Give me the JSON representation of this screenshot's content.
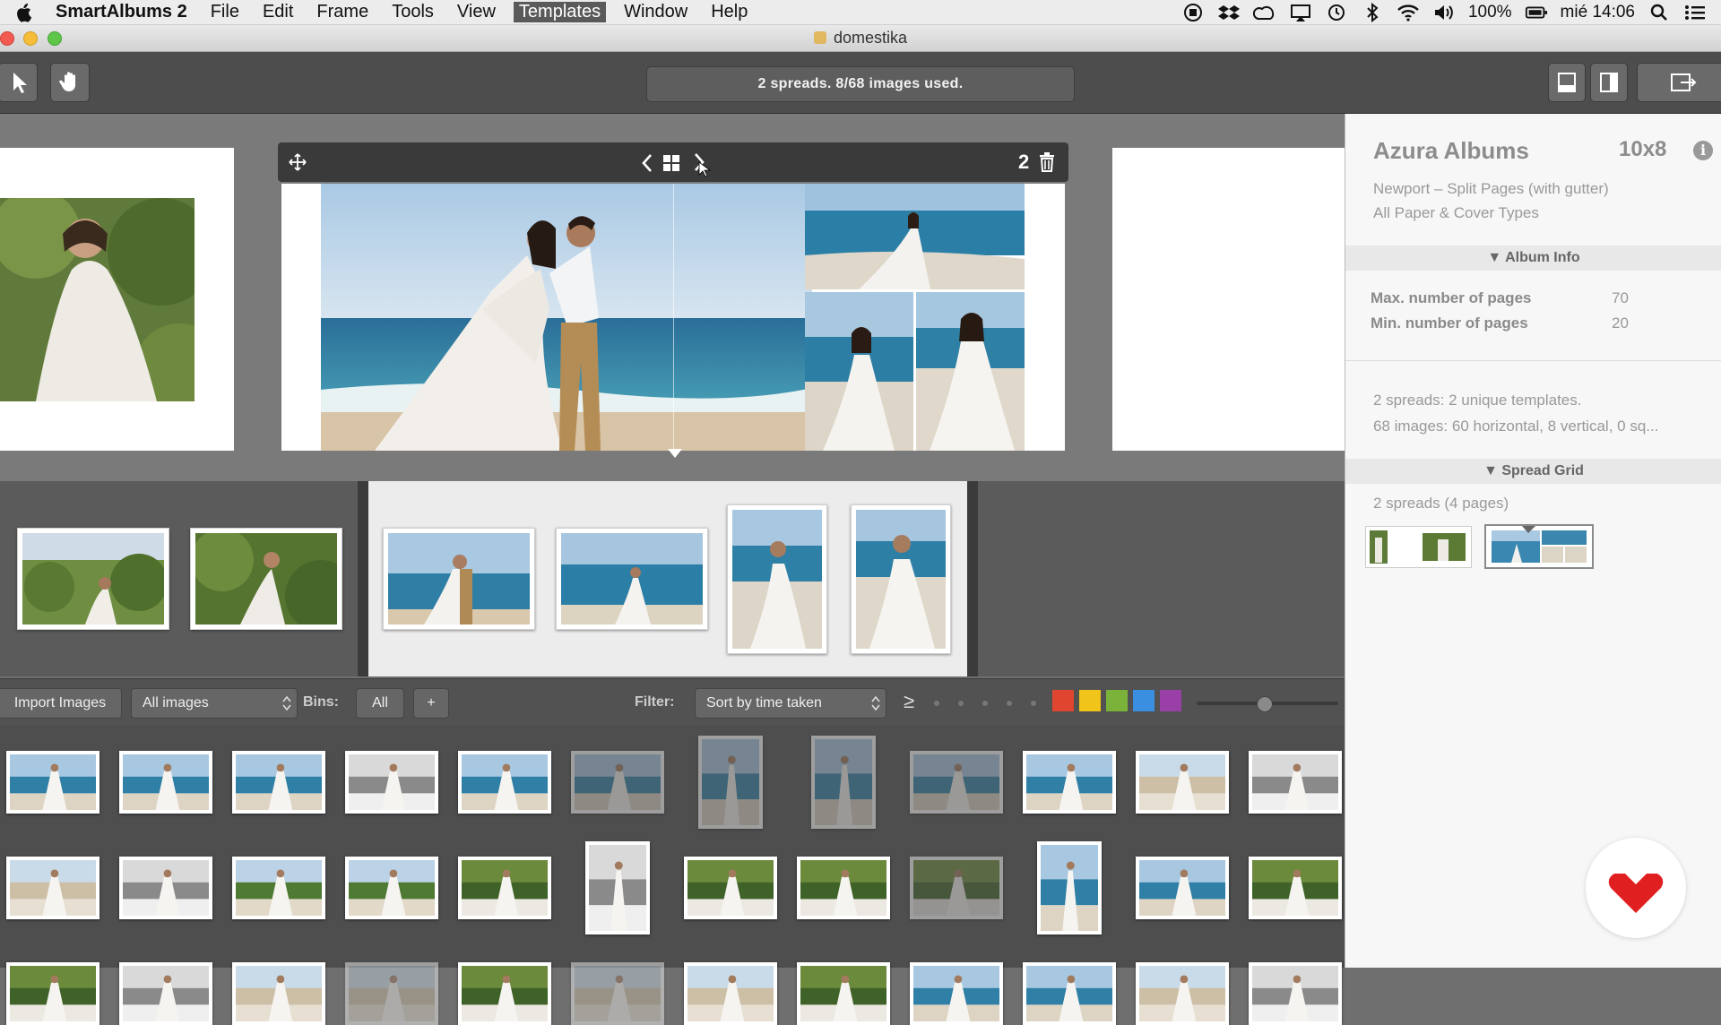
{
  "menubar": {
    "app": "SmartAlbums 2",
    "items": [
      "File",
      "Edit",
      "Frame",
      "Tools",
      "View",
      "Templates",
      "Window",
      "Help"
    ],
    "active": "Templates",
    "battery": "100%",
    "clock": "mié 14:06"
  },
  "window": {
    "title": "domestika"
  },
  "toolbar": {
    "status": "2 spreads. 8/68 images used."
  },
  "spread": {
    "page_number": "2"
  },
  "filterbar": {
    "import_label": "Import Images",
    "images_select": "All images",
    "bins_label": "Bins:",
    "bins_all": "All",
    "bins_add": "+",
    "filter_label": "Filter:",
    "sort_select": "Sort by time taken",
    "rating_symbol": "≥",
    "colors": [
      "#e0452f",
      "#f0c419",
      "#7bb33a",
      "#3a8fe0",
      "#9b3fa8"
    ]
  },
  "sidebar": {
    "vendor": "Azura Albums",
    "size": "10x8",
    "template": "Newport – Split Pages (with gutter)",
    "paper": "All Paper & Cover Types",
    "album_info_header": "Album Info",
    "max_pages_label": "Max. number of pages",
    "max_pages": "70",
    "min_pages_label": "Min. number of pages",
    "min_pages": "20",
    "summary_line1": "2 spreads: 2 unique templates.",
    "summary_line2": "68 images: 60 horizontal, 8 vertical, 0 sq...",
    "spread_grid_header": "Spread Grid",
    "spread_grid_count": "2 spreads (4 pages)"
  }
}
